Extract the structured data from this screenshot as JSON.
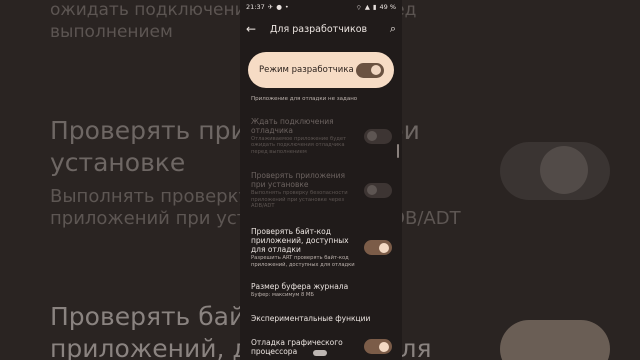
{
  "background": {
    "line1": "ожидать подключения отладчика перед",
    "line2": "выполнением",
    "line3": "Проверять приложения при",
    "line4": "установке",
    "line5": "Выполнять проверку безопасности",
    "line6": "приложений при установке через ADB/ADT",
    "line7": "Проверять байт-код",
    "line8": "приложений, доступных для"
  },
  "status_bar": {
    "time": "21:37",
    "battery": "49 %"
  },
  "app_bar": {
    "title": "Для разработчиков"
  },
  "master_switch": {
    "label": "Режим разработчика",
    "on": true
  },
  "debug_app_note": "Приложение для отладки не задано",
  "settings": [
    {
      "title": "Ждать подключения отладчика",
      "summary": "Отлаживаемое приложение будет ожидать подключения отладчика перед выполнением",
      "enabled": false,
      "on": false
    },
    {
      "title": "Проверять приложения при установке",
      "summary": "Выполнять проверку безопасности приложений при установке через ADB/ADT",
      "enabled": false,
      "on": false
    },
    {
      "title": "Проверять байт-код приложений, доступных для отладки",
      "summary": "Разрешить ART проверять байт-код приложений, доступных для отладки",
      "enabled": true,
      "on": true
    },
    {
      "title": "Размер буфера журнала",
      "summary": "Буфер: максимум 8 МБ"
    },
    {
      "title": "Экспериментальные функции",
      "summary": ""
    },
    {
      "title": "Отладка графического процессора",
      "summary": "",
      "enabled": true,
      "on": true
    }
  ],
  "colors": {
    "accent": "#f6dcc5",
    "toggle_on": "#7b5c48",
    "surface": "#201b1a"
  }
}
